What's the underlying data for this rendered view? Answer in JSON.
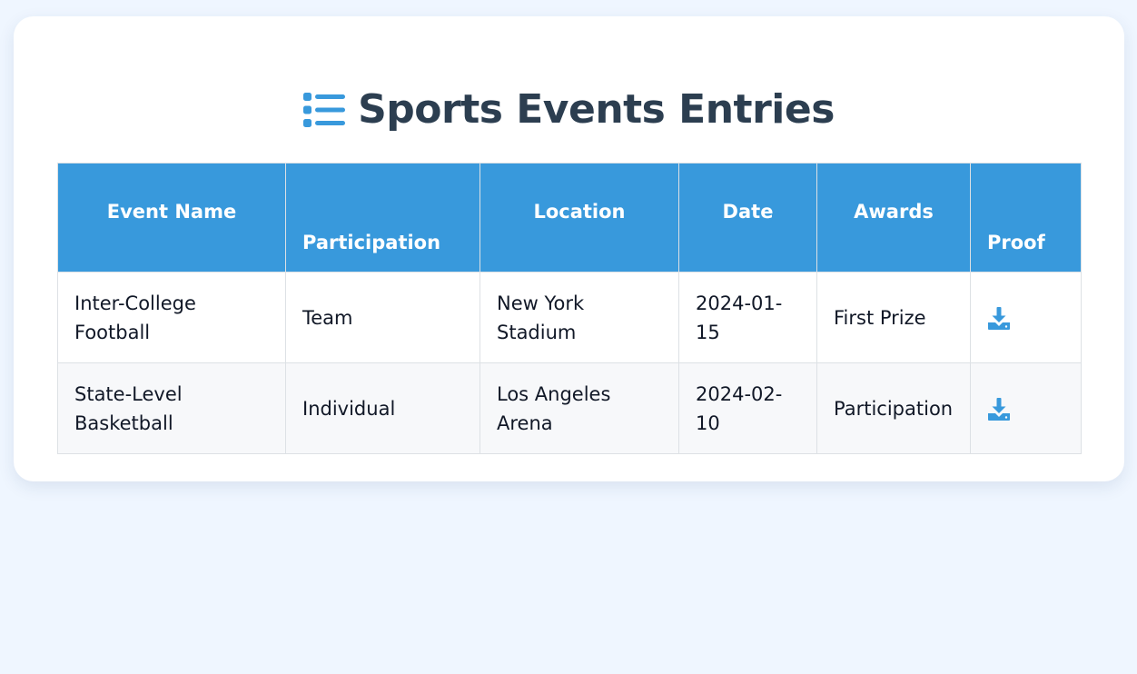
{
  "page": {
    "title": "Sports Events Entries",
    "title_icon": "list-icon",
    "accent_color": "#3899dc",
    "title_color": "#2c3e50"
  },
  "table": {
    "headers": [
      "Event Name",
      "Participation",
      "Location",
      "Date",
      "Awards",
      "Proof"
    ],
    "rows": [
      {
        "event_name": "Inter-College Football",
        "participation": "Team",
        "location": "New York Stadium",
        "date": "2024-01-15",
        "awards": "First Prize",
        "proof_icon": "download-icon"
      },
      {
        "event_name": "State-Level Basketball",
        "participation": "Individual",
        "location": "Los Angeles Arena",
        "date": "2024-02-10",
        "awards": "Participation",
        "proof_icon": "download-icon"
      }
    ]
  }
}
